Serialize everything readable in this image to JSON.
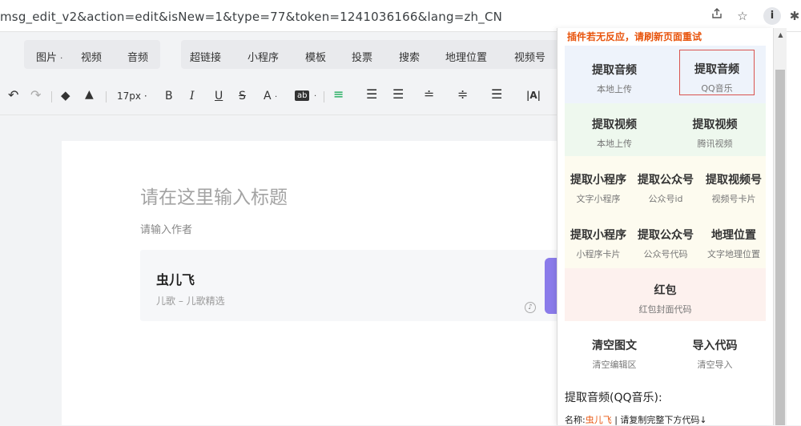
{
  "browser": {
    "url": "msg_edit_v2&action=edit&isNew=1&type=77&token=1241036166&lang=zh_CN",
    "icons": [
      "share-icon",
      "star-icon",
      "extension-info-icon",
      "puzzle-icon"
    ],
    "ext_info_label": "i"
  },
  "insert_bar": {
    "items": [
      "图片",
      "视频",
      "音频",
      "超链接",
      "小程序",
      "模板",
      "投票",
      "搜索",
      "地理位置",
      "视频号"
    ],
    "dropdown_marker": "·"
  },
  "format_bar": {
    "font_size": "17px",
    "font_size_marker": "·",
    "bold": "B",
    "italic": "I",
    "underline": "U",
    "strike": "S",
    "font_color": "A",
    "bg_color": "ab",
    "letter_spacing": "|A|"
  },
  "article": {
    "title_placeholder": "请在这里输入标题",
    "author_placeholder": "请输入作者",
    "music": {
      "name": "虫儿飞",
      "subtitle": "儿歌 – 儿歌精选"
    }
  },
  "panel": {
    "warning": "插件若无反应，请刷新页面重试",
    "tiles": [
      {
        "title": "提取音频",
        "sub": "本地上传"
      },
      {
        "title": "提取音频",
        "sub": "QQ音乐"
      },
      {
        "title": "提取视频",
        "sub": "本地上传"
      },
      {
        "title": "提取视频",
        "sub": "腾讯视频"
      },
      {
        "title": "提取小程序",
        "sub": "文字小程序"
      },
      {
        "title": "提取公众号",
        "sub": "公众号id"
      },
      {
        "title": "提取视频号",
        "sub": "视频号卡片"
      },
      {
        "title": "提取小程序",
        "sub": "小程序卡片"
      },
      {
        "title": "提取公众号",
        "sub": "公众号代码"
      },
      {
        "title": "地理位置",
        "sub": "文字地理位置"
      },
      {
        "title": "红包",
        "sub": "红包封面代码"
      },
      {
        "title": "清空图文",
        "sub": "清空编辑区"
      },
      {
        "title": "导入代码",
        "sub": "清空导入"
      }
    ],
    "result_title": "提取音频(QQ音乐):",
    "result_prefix": "名称:",
    "result_name": "虫儿飞",
    "result_suffix": " | 请复制完整下方代码↓"
  },
  "colors": {
    "warning": "#e8540c",
    "audio_tile_bg": "#eef3fb",
    "video_tile_bg": "#eef8ee",
    "mini_tile_bg": "#fdfbef",
    "redpack_tile_bg": "#fdf1ee",
    "selected_border": "#d9534f",
    "card_accent": "#8a7bea"
  }
}
